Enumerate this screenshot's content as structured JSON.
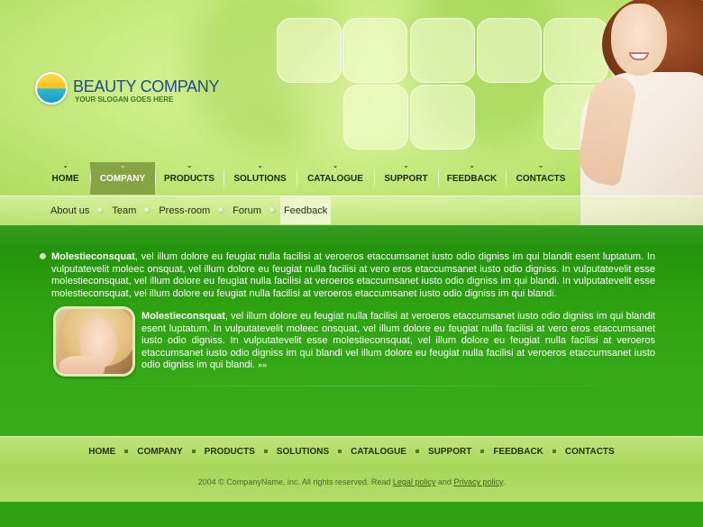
{
  "brand": {
    "name": "BEAUTY COMPANY",
    "slogan": "YOUR SLOGAN GOES HERE"
  },
  "top_nav": {
    "items": [
      {
        "label": "HOME"
      },
      {
        "label": "COMPANY",
        "active": true
      },
      {
        "label": "PRODUCTS"
      },
      {
        "label": "SOLUTIONS"
      },
      {
        "label": "CATALOGUE"
      },
      {
        "label": "SUPPORT"
      },
      {
        "label": "FEEDBACK"
      },
      {
        "label": "CONTACTS"
      }
    ]
  },
  "sub_nav": {
    "items": [
      {
        "label": "About us"
      },
      {
        "label": "Team"
      },
      {
        "label": "Press-room"
      },
      {
        "label": "Forum"
      },
      {
        "label": "Feedback",
        "active": true
      }
    ]
  },
  "content": {
    "para1_lead": "Molestieconsquat",
    "para1_text": ", vel illum dolore eu feugiat nulla facilisi at veroeros etaccumsanet iusto odio digniss im qui blandit esent luptatum. In vulputatevelit moleec onsquat, vel illum dolore eu feugiat nulla facilisi at vero eros etaccumsanet iusto odio digniss. In vulputatevelit esse molestieconsquat, vel illum dolore eu feugiat nulla facilisi at veroeros etaccumsanet iusto odio digniss im qui blandi. In vulputatevelit esse molestieconsquat, vel illum dolore eu feugiat nulla facilisi at veroeros etaccumsanet iusto odio digniss im qui blandi.",
    "para2_lead": "Molestieconsquat",
    "para2_text": ", vel illum dolore eu feugiat nulla facilisi at veroeros etaccumsanet iusto odio digniss im qui blandit esent luptatum. In vulputatevelit moleec onsquat, vel illum dolore eu feugiat nulla facilisi at vero eros etaccumsanet iusto odio digniss. In vulputatevelit esse molestieconsquat, vel illum dolore eu feugiat nulla facilisi at veroeros etaccumsanet iusto odio digniss im qui blandi vel illum dolore eu feugiat nulla facilisi at veroeros etaccumsanet iusto odio digniss im qui blandi.",
    "more_arrow": "»»"
  },
  "footer_nav": {
    "items": [
      {
        "label": "HOME"
      },
      {
        "label": "COMPANY"
      },
      {
        "label": "PRODUCTS"
      },
      {
        "label": "SOLUTIONS"
      },
      {
        "label": "CATALOGUE"
      },
      {
        "label": "SUPPORT"
      },
      {
        "label": "FEEDBACK"
      },
      {
        "label": "CONTACTS"
      }
    ]
  },
  "footer": {
    "copyright_prefix": "2004 © CompanyName, inc. All rights reserved. Read ",
    "legal_link": "Legal policy",
    "and_text": " and ",
    "privacy_link": "Privacy policy",
    "suffix": "."
  },
  "colors": {
    "header_green": "#cdee88",
    "content_green": "#2fa312",
    "active_tab": "#86a443",
    "logo_text": "#234a8a"
  },
  "icons": {
    "logo": "sun-wave-logo-icon",
    "nav_marker": "chevron-down-icon",
    "sub_separator": "dot-icon",
    "bullet": "bullet-icon"
  }
}
